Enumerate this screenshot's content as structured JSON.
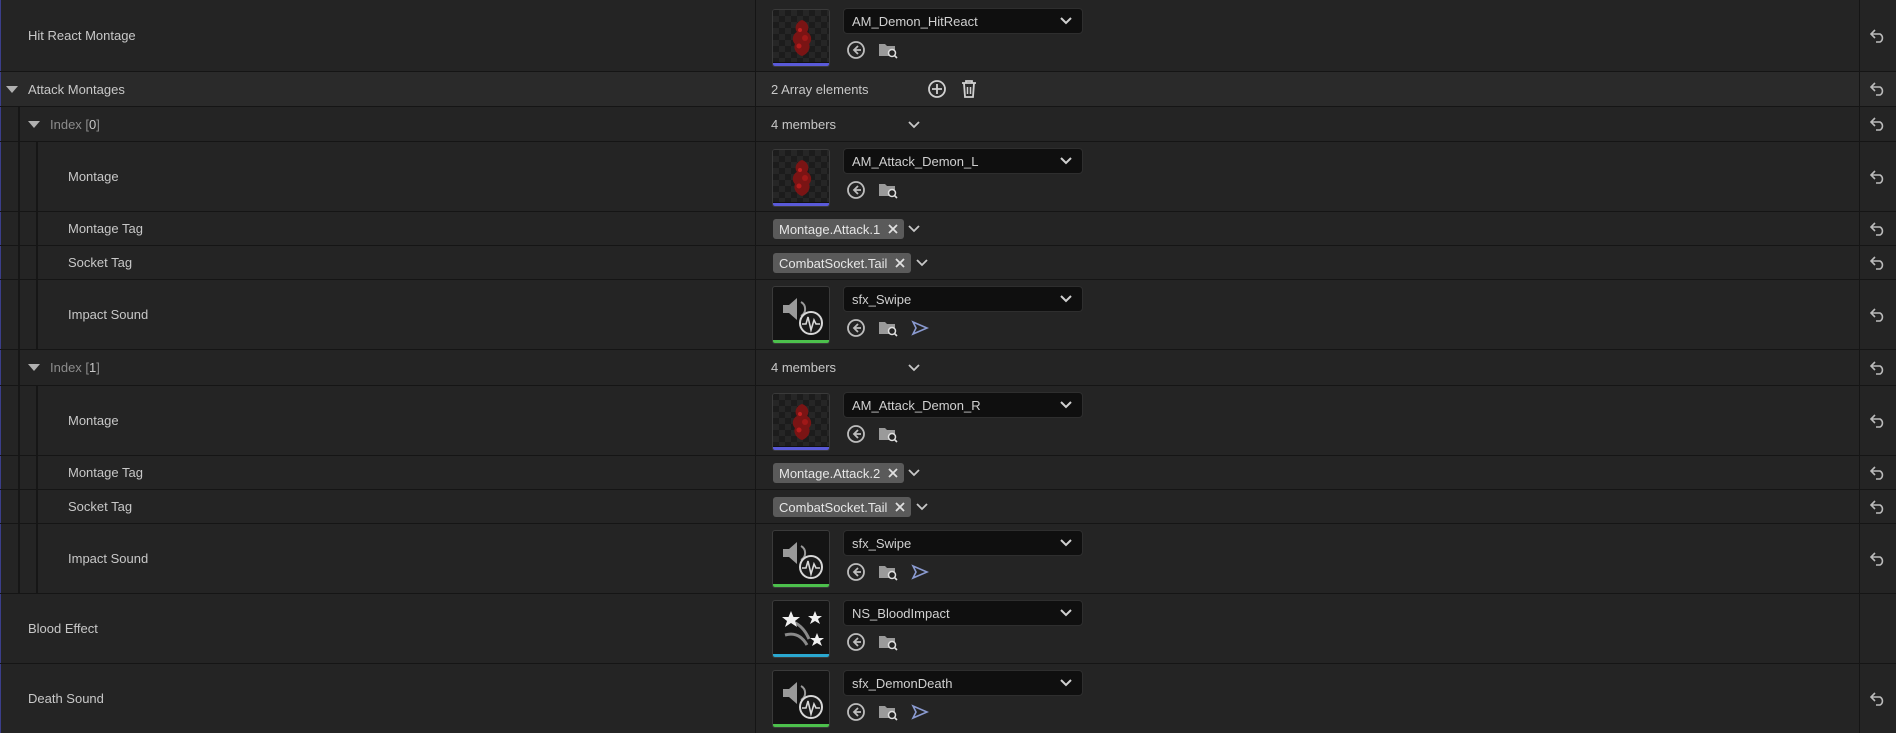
{
  "rows": {
    "hit_react": {
      "label": "Hit React Montage",
      "asset": "AM_Demon_HitReact"
    },
    "attack_montages": {
      "label": "Attack Montages",
      "value": "2 Array elements"
    },
    "index0": {
      "label_prefix": "Index [",
      "index": "0",
      "label_suffix": "]",
      "value": "4 members",
      "montage": {
        "label": "Montage",
        "asset": "AM_Attack_Demon_L"
      },
      "montage_tag": {
        "label": "Montage Tag",
        "tag": "Montage.Attack.1"
      },
      "socket_tag": {
        "label": "Socket Tag",
        "tag": "CombatSocket.Tail"
      },
      "impact_sound": {
        "label": "Impact Sound",
        "asset": "sfx_Swipe"
      }
    },
    "index1": {
      "label_prefix": "Index [",
      "index": "1",
      "label_suffix": "]",
      "value": "4 members",
      "montage": {
        "label": "Montage",
        "asset": "AM_Attack_Demon_R"
      },
      "montage_tag": {
        "label": "Montage Tag",
        "tag": "Montage.Attack.2"
      },
      "socket_tag": {
        "label": "Socket Tag",
        "tag": "CombatSocket.Tail"
      },
      "impact_sound": {
        "label": "Impact Sound",
        "asset": "sfx_Swipe"
      }
    },
    "blood_effect": {
      "label": "Blood Effect",
      "asset": "NS_BloodImpact"
    },
    "death_sound": {
      "label": "Death Sound",
      "asset": "sfx_DemonDeath"
    }
  },
  "colors": {
    "montage_bar": "#5a5ad8",
    "sound_bar": "#4cc04c",
    "niagara_bar": "#2aa8d0"
  },
  "icons": [
    "use-selected-icon",
    "browse-icon",
    "play-icon",
    "add-element-icon",
    "delete-all-icon",
    "reset-to-default-icon",
    "chevron-down-icon",
    "clear-tag-icon"
  ]
}
